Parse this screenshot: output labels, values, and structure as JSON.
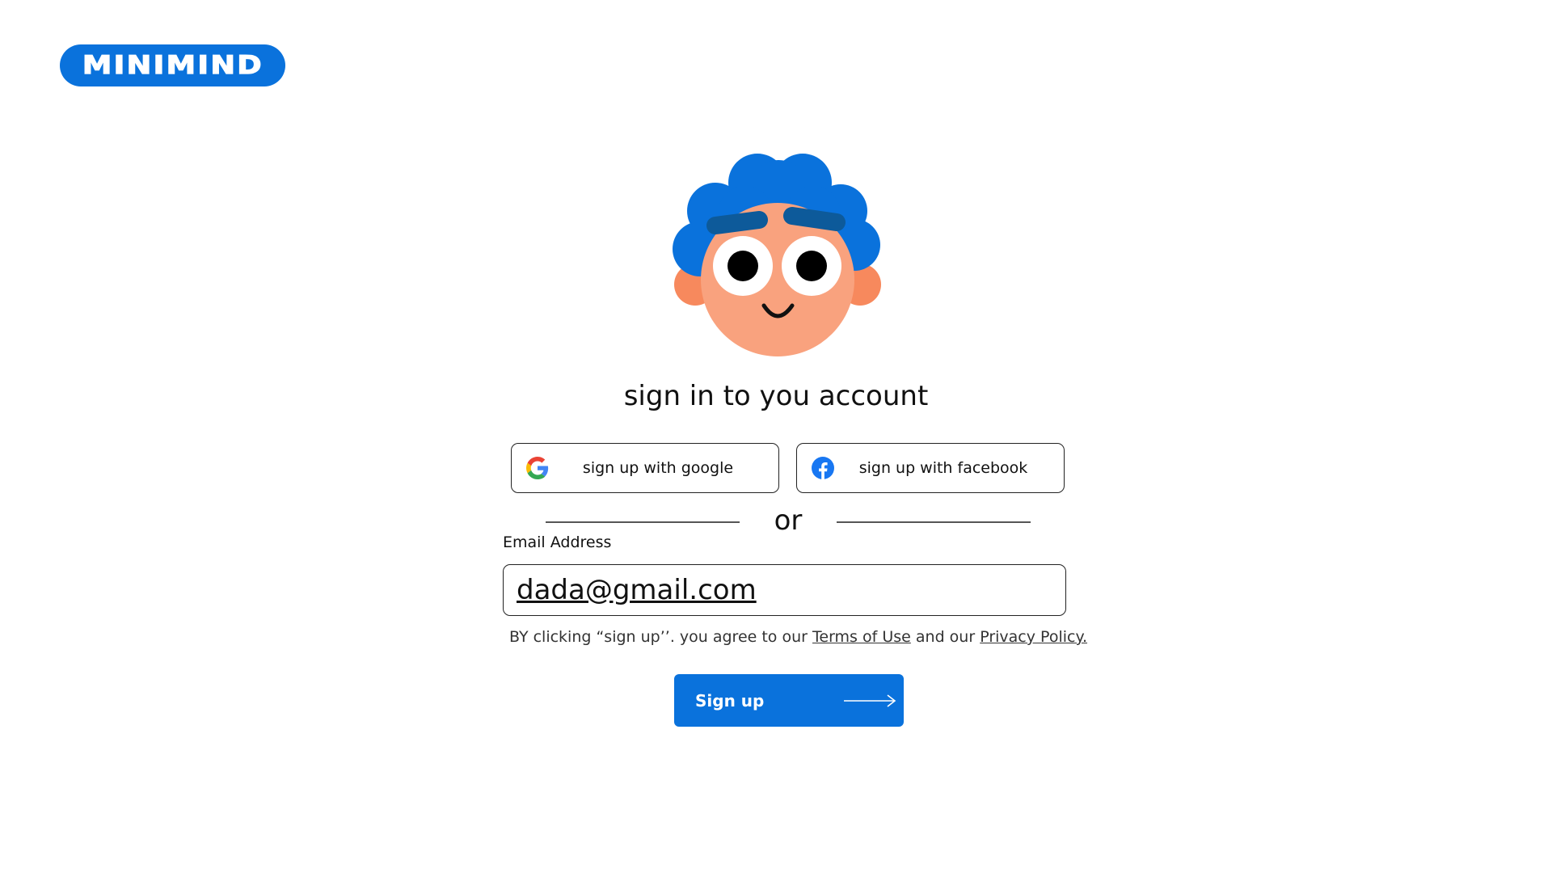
{
  "brand": {
    "logo_text": "MINIMIND",
    "accent_color": "#0a72dc"
  },
  "mascot": {
    "icon": "smiling-curly-haired-face",
    "hair_color": "#0a72dc",
    "skin_color": "#f9a27e",
    "brow_color": "#0d5a9a"
  },
  "heading": "sign in to you account",
  "social": {
    "google": {
      "label": "sign up with google",
      "icon": "google-icon"
    },
    "facebook": {
      "label": "sign up with facebook",
      "icon": "facebook-icon"
    }
  },
  "divider": {
    "text": "or"
  },
  "email": {
    "label": "Email Address",
    "value": "dada@gmail.com"
  },
  "terms": {
    "prefix": "BY clicking “sign up’’. you agree to our",
    "terms_link": "Terms of Use",
    "middle": "and our",
    "privacy_link": "Privacy Policy."
  },
  "signup": {
    "label": "Sign up",
    "icon": "arrow-right-icon"
  }
}
